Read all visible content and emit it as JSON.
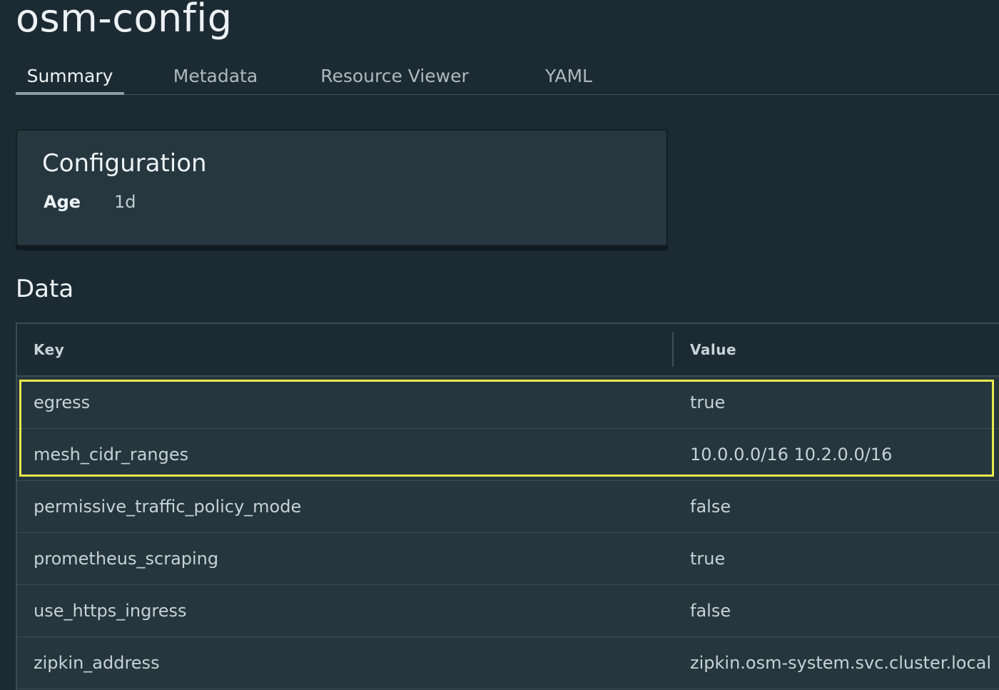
{
  "page": {
    "title": "osm-config"
  },
  "tabs": [
    {
      "label": "Summary",
      "active": true
    },
    {
      "label": "Metadata",
      "active": false
    },
    {
      "label": "Resource Viewer",
      "active": false
    },
    {
      "label": "YAML",
      "active": false
    }
  ],
  "configuration": {
    "title": "Configuration",
    "age_label": "Age",
    "age_value": "1d"
  },
  "data_section": {
    "title": "Data",
    "columns": {
      "key": "Key",
      "value": "Value"
    },
    "rows": [
      {
        "key": "egress",
        "value": "true"
      },
      {
        "key": "mesh_cidr_ranges",
        "value": "10.0.0.0/16 10.2.0.0/16"
      },
      {
        "key": "permissive_traffic_policy_mode",
        "value": "false"
      },
      {
        "key": "prometheus_scraping",
        "value": "true"
      },
      {
        "key": "use_https_ingress",
        "value": "false"
      },
      {
        "key": "zipkin_address",
        "value": "zipkin.osm-system.svc.cluster.local"
      }
    ]
  },
  "colors": {
    "background": "#1c2b33",
    "card_background": "#263740",
    "highlight": "#e9e94a"
  }
}
